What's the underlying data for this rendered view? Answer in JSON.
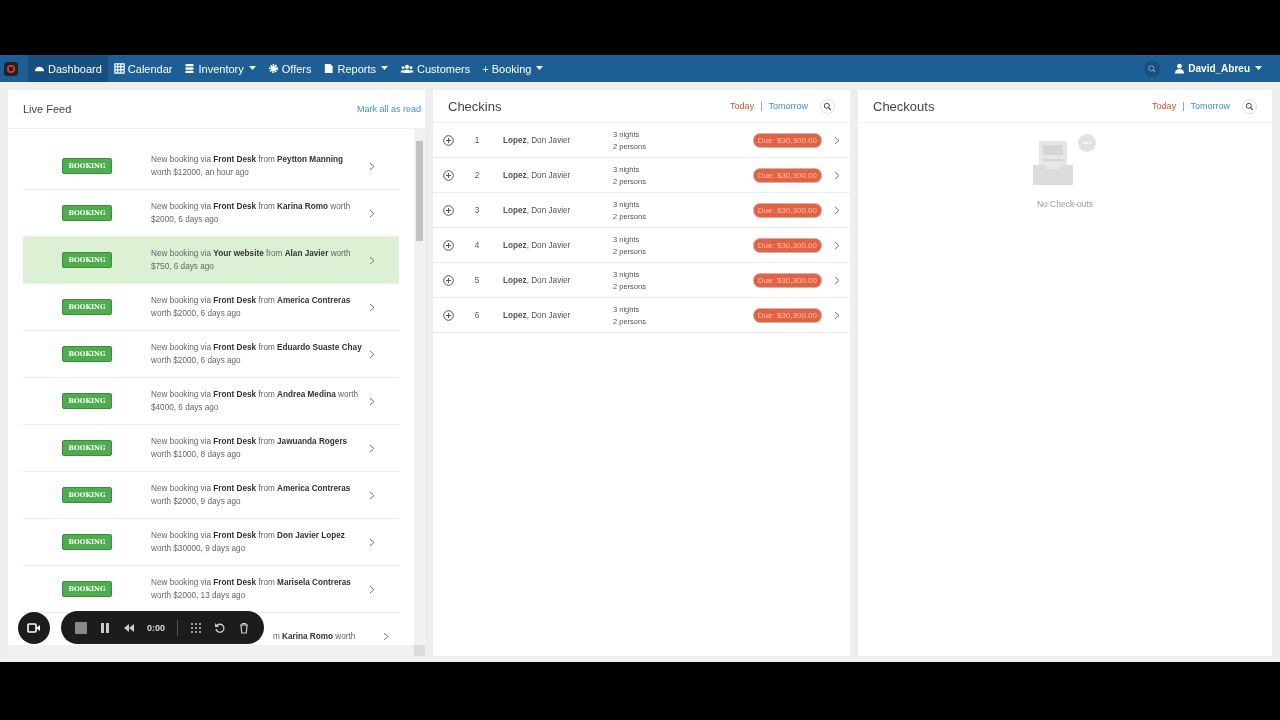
{
  "nav": {
    "items": [
      {
        "label": "Dashboard",
        "selected": true,
        "caret": false
      },
      {
        "label": "Calendar",
        "selected": false,
        "caret": false
      },
      {
        "label": "Inventory",
        "selected": false,
        "caret": true
      },
      {
        "label": "Offers",
        "selected": false,
        "caret": false
      },
      {
        "label": "Reports",
        "selected": false,
        "caret": true
      },
      {
        "label": "Customers",
        "selected": false,
        "caret": false
      },
      {
        "label": "+ Booking",
        "selected": false,
        "caret": true
      }
    ],
    "user": "David_Abreu"
  },
  "live_feed": {
    "title": "Live Feed",
    "action": "Mark all as read",
    "items": [
      {
        "badge": "BOOKING",
        "text": "New booking via **Front Desk** from **Peytton Manning** worth $12000, an hour ago",
        "selected": false
      },
      {
        "badge": "BOOKING",
        "text": "New booking via **Front Desk** from **Karina Romo** worth $2000, 6 days ago",
        "selected": false
      },
      {
        "badge": "BOOKING",
        "text": "New booking via **Your website** from **Alan Javier** worth $750, 6 days ago",
        "selected": true
      },
      {
        "badge": "BOOKING",
        "text": "New booking via **Front Desk** from **America Contreras** worth $2000, 6 days ago",
        "selected": false
      },
      {
        "badge": "BOOKING",
        "text": "New booking via **Front Desk** from **Eduardo Suaste Chay** worth $2000, 6 days ago",
        "selected": false
      },
      {
        "badge": "BOOKING",
        "text": "New booking via **Front Desk** from **Andrea Medina** worth $4000, 6 days ago",
        "selected": false
      },
      {
        "badge": "BOOKING",
        "text": "New booking via **Front Desk** from **Jawuanda Rogers** worth $1000, 8 days ago",
        "selected": false
      },
      {
        "badge": "BOOKING",
        "text": "New booking via **Front Desk** from **America Contreras** worth $2000, 9 days ago",
        "selected": false
      },
      {
        "badge": "BOOKING",
        "text": "New booking via **Front Desk** from **Don Javier Lopez** worth $30000, 9 days ago",
        "selected": false
      },
      {
        "badge": "BOOKING",
        "text": "New booking via **Front Desk** from **Marisela Contreras** worth $2000, 13 days ago",
        "selected": false
      },
      {
        "text": "m **Karina Romo** worth",
        "selected": false
      }
    ]
  },
  "checkins": {
    "title": "Checkins",
    "separator": "|",
    "filters": [
      {
        "label": "Today",
        "selected": true
      },
      {
        "label": "Tomorrow",
        "selected": false
      }
    ],
    "rows": [
      {
        "number": "1",
        "last_name": "Lopez",
        "first_name": ", Don Javier",
        "nights": "3 nights",
        "persons": "2 persons",
        "due": "Due: $30,300.00"
      },
      {
        "number": "2",
        "last_name": "Lopez",
        "first_name": ", Don Javier",
        "nights": "3 nights",
        "persons": "2 persons",
        "due": "Due: $30,300.00"
      },
      {
        "number": "3",
        "last_name": "Lopez",
        "first_name": ", Don Javier",
        "nights": "3 nights",
        "persons": "2 persons",
        "due": "Due: $30,300.00"
      },
      {
        "number": "4",
        "last_name": "Lopez",
        "first_name": ", Don Javier",
        "nights": "3 nights",
        "persons": "2 persons",
        "due": "Due: $30,300.00"
      },
      {
        "number": "5",
        "last_name": "Lopez",
        "first_name": ", Don Javier",
        "nights": "3 nights",
        "persons": "2 persons",
        "due": "Due: $30,300.00"
      },
      {
        "number": "6",
        "last_name": "Lopez",
        "first_name": ", Don Javier",
        "nights": "3 nights",
        "persons": "2 persons",
        "due": "Due: $30,300.00"
      }
    ]
  },
  "checkouts": {
    "title": "Checkouts",
    "separator": "|",
    "filters": [
      {
        "label": "Today",
        "selected": true
      },
      {
        "label": "Tomorrow",
        "selected": false
      }
    ],
    "empty": "No Check-outs"
  },
  "recorder": {
    "time": "0:00"
  }
}
